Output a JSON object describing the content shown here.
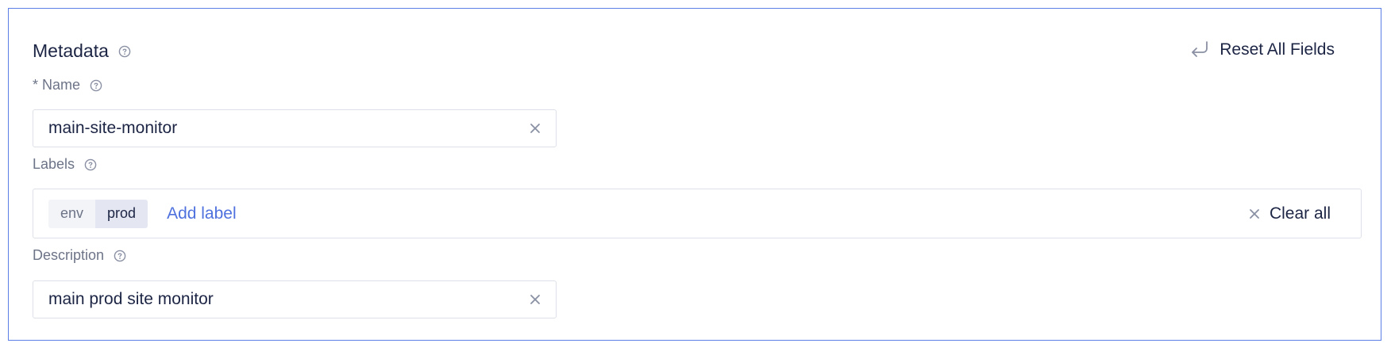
{
  "section": {
    "title": "Metadata",
    "reset_label": "Reset All Fields"
  },
  "name_field": {
    "label": "* Name",
    "value": "main-site-monitor"
  },
  "labels_field": {
    "label": "Labels",
    "chips": [
      {
        "key": "env",
        "value": "prod"
      }
    ],
    "add_label": "Add label",
    "clear_all": "Clear all"
  },
  "description_field": {
    "label": "Description",
    "value": "main prod site monitor"
  },
  "colors": {
    "accent": "#4e71de",
    "border_focus": "#5b7fe6",
    "text": "#1d2545",
    "muted": "#6d7488"
  },
  "icons": [
    "help-icon",
    "reset-icon",
    "clear-icon",
    "close-icon"
  ]
}
